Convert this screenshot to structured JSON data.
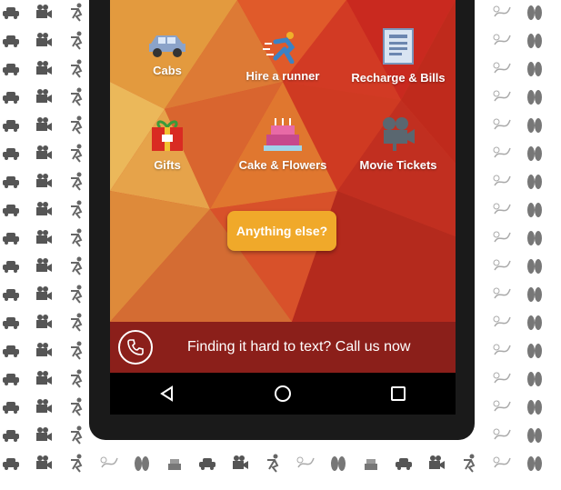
{
  "services": [
    {
      "label": "Cabs",
      "icon": "car-icon"
    },
    {
      "label": "Hire a runner",
      "icon": "runner-icon"
    },
    {
      "label": "Recharge & Bills",
      "icon": "bill-icon"
    },
    {
      "label": "Gifts",
      "icon": "gift-icon"
    },
    {
      "label": "Cake & Flowers",
      "icon": "cake-icon"
    },
    {
      "label": "Movie Tickets",
      "icon": "movie-camera-icon"
    }
  ],
  "anything_else_label": "Anything else?",
  "call_bar": {
    "text": "Finding it hard to text? Call us now",
    "icon": "phone-icon"
  },
  "navbar": {
    "back_icon": "back-icon",
    "home_icon": "home-icon",
    "recents_icon": "recents-icon"
  },
  "colors": {
    "call_bar": "#8b1f1a",
    "button": "#f0a92a",
    "nav": "#000000"
  }
}
